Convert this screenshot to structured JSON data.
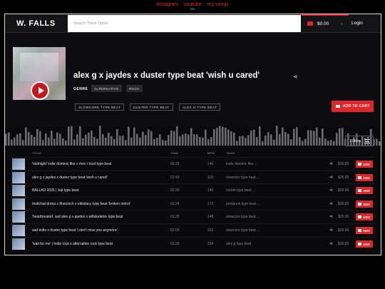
{
  "toplinks": [
    "instagram",
    "youtube",
    "my songs"
  ],
  "colors": {
    "accent": "#e0262b",
    "background": "#0a0a0c"
  },
  "header": {
    "logo": "W. FALLS",
    "search_placeholder": "Search Track Types",
    "cart_total": "$0.00",
    "login": "Login"
  },
  "hero": {
    "title": "alex g x jaydes x duster type beat 'wish u cared'",
    "genre_label": "GENRE",
    "genres": [
      "ALTERNATIVE",
      "ROCK"
    ],
    "tags": [
      "SLOWCORE TYPE BEAT",
      "DUSTER TYPE BEAT",
      "ALEX G TYPE BEAT"
    ],
    "add_to_cart": "ADD TO CART"
  },
  "filters_label": "Filters",
  "columns": [
    "TITLE",
    "TIME",
    "BPM",
    "TAGS"
  ],
  "tracks": [
    {
      "title": "'midnight' indie dominic fike x men i trust type beat",
      "time": "02:15",
      "bpm": "140",
      "tags": "indie dominic fike ...",
      "price": "$29.95",
      "add": "ADD"
    },
    {
      "title": "alex g x jaydes x duster type beat 'wish u cared'",
      "time": "01:43",
      "bpm": "110",
      "tags": "slowcore type beat ...",
      "price": "$29.95",
      "add": "ADD"
    },
    {
      "title": "BALLAD 2025 | Joji type beat",
      "time": "02:30",
      "bpm": "140",
      "tags": "corbin type beat ...",
      "price": "$29.95",
      "add": "ADD"
    },
    {
      "title": "mokchat dorna x tfnxomch x ekkstacy type beat 'broken mirror'",
      "time": "02:24",
      "bpm": "173",
      "tags": "postpunk type beat ...",
      "price": "$29.95",
      "add": "ADD"
    },
    {
      "title": "'heartbreaker' sad alex g x jaydes x wifiskeleton type beat",
      "time": "01:25",
      "bpm": "148",
      "tags": "slowcore type beat ...",
      "price": "$29.95",
      "add": "ADD"
    },
    {
      "title": "sad indie x duster type beat 'i don't miss you anymore'",
      "time": "02:03",
      "bpm": "151",
      "tags": "slowcore type beat ...",
      "price": "$29.95",
      "add": "ADD"
    },
    {
      "title": "'wait for me' | indie rock x alternative rock type beat",
      "time": "02:29",
      "bpm": "154",
      "tags": "alex g type beat",
      "price": "$29.95",
      "add": "ADD"
    }
  ]
}
